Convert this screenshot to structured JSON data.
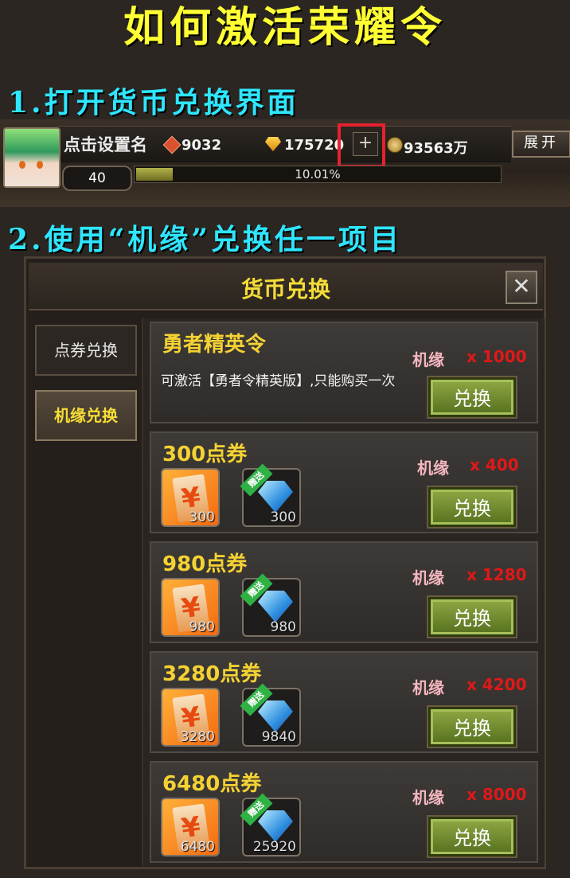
{
  "page_title": "如何激活荣耀令",
  "step1": "1.打开货币兑换界面",
  "step2": "2.使用“机缘”兑换任一项目",
  "status_bar": {
    "player_name": "点击设置名",
    "red_gems": "9032",
    "gold_gems": "175720",
    "add_button": "+",
    "coins": "93563万",
    "expand_button": "展开",
    "level": "40",
    "exp_percent_text": "10.01%",
    "exp_fraction": 0.1001
  },
  "dialog": {
    "title": "货币兑换",
    "close_icon": "close-icon",
    "tabs": [
      {
        "label": "点券兑换",
        "active": false
      },
      {
        "label": "机缘兑换",
        "active": true
      }
    ],
    "cost_label": "机缘",
    "exchange_label": "兑换",
    "items": [
      {
        "title": "勇者精英令",
        "description": "可激活【勇者令精英版】,只能购买一次",
        "cost": "x 1000"
      },
      {
        "title": "300点券",
        "cost": "x 400",
        "coupon_qty": "300",
        "diamond_qty": "300",
        "ribbon": "赠送"
      },
      {
        "title": "980点券",
        "cost": "x 1280",
        "coupon_qty": "980",
        "diamond_qty": "980",
        "ribbon": "赠送"
      },
      {
        "title": "3280点券",
        "cost": "x 4200",
        "coupon_qty": "3280",
        "diamond_qty": "9840",
        "ribbon": "赠送"
      },
      {
        "title": "6480点券",
        "cost": "x 8000",
        "coupon_qty": "6480",
        "diamond_qty": "25920",
        "ribbon": "赠送"
      }
    ]
  },
  "colors": {
    "title_yellow": "#ffff33",
    "step_cyan": "#2ee6ff",
    "highlight_red": "#e5222e",
    "item_title_gold": "#f5d233",
    "cost_red": "#e01818",
    "button_green": "#7a9a36"
  }
}
